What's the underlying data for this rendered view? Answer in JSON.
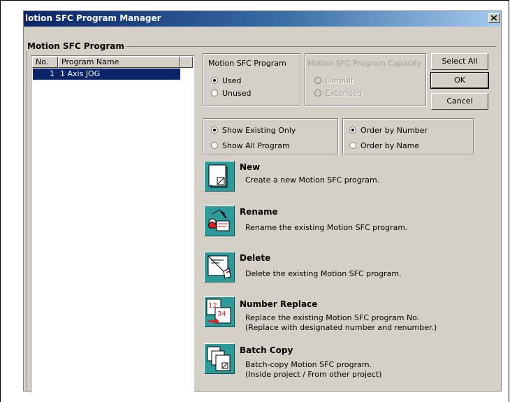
{
  "window": {
    "title": "lotion SFC Program Manager"
  },
  "program_group": {
    "legend": "Motion SFC Program"
  },
  "program_list": {
    "columns": [
      "No.",
      "Program Name"
    ],
    "rows": [
      {
        "no": "1",
        "name": "1 Axis JOG"
      }
    ]
  },
  "usage_group": {
    "legend": "Motion SFC Program",
    "options": [
      "Used",
      "Unused"
    ],
    "selected": "Used"
  },
  "capacity_group": {
    "legend": "Motion SFC Program Capacity",
    "options": [
      "Default",
      "Extended"
    ]
  },
  "buttons": {
    "select_all": "Select All",
    "ok": "OK",
    "cancel": "Cancel"
  },
  "show_group": {
    "options": [
      "Show Existing Only",
      "Show All Program"
    ],
    "selected": "Show Existing Only"
  },
  "order_group": {
    "options": [
      "Order by Number",
      "Order by Name"
    ],
    "selected": "Order by Number"
  },
  "actions": [
    {
      "title": "New",
      "desc": "Create a new Motion SFC program.",
      "icon": "new-icon"
    },
    {
      "title": "Rename",
      "desc": "Rename the existing Motion SFC program.",
      "icon": "rename-icon"
    },
    {
      "title": "Delete",
      "desc": "Delete the existing Motion SFC program.",
      "icon": "delete-icon"
    },
    {
      "title": "Number Replace",
      "desc": "Replace the existing Motion SFC program No.\n(Replace with designated number and renumber.)",
      "icon": "number-replace-icon",
      "icon_text": [
        "12",
        "34"
      ]
    },
    {
      "title": "Batch Copy",
      "desc": "Batch-copy Motion SFC program.\n(Inside project / From other project)",
      "icon": "batch-copy-icon"
    }
  ]
}
